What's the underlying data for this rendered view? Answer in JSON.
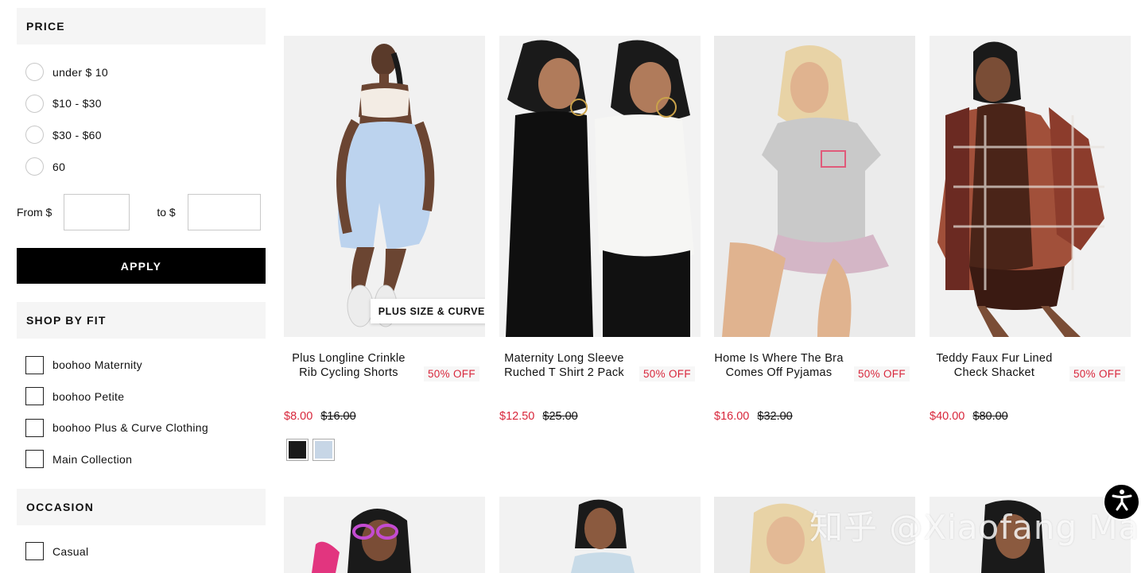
{
  "filters": {
    "price": {
      "heading": "PRICE",
      "options": [
        "under $ 10",
        "$10 - $30",
        "$30 - $60",
        "60"
      ],
      "from_label": "From $",
      "to_label": "to $",
      "from_value": "",
      "to_value": "",
      "apply_label": "APPLY"
    },
    "fit": {
      "heading": "SHOP BY FIT",
      "options": [
        "boohoo Maternity",
        "boohoo Petite",
        "boohoo Plus & Curve Clothing",
        "Main Collection"
      ]
    },
    "occasion": {
      "heading": "OCCASION",
      "options": [
        "Casual"
      ]
    }
  },
  "products": [
    {
      "name": "Plus Longline Crinkle Rib Cycling Shorts",
      "discount": "50% OFF",
      "price": "$8.00",
      "original_price": "$16.00",
      "badge": "PLUS SIZE & CURVE",
      "swatches": [
        "#1a1a1a",
        "#c7d6e6"
      ]
    },
    {
      "name": "Maternity Long Sleeve Ruched T Shirt 2 Pack",
      "discount": "50% OFF",
      "price": "$12.50",
      "original_price": "$25.00"
    },
    {
      "name": "Home Is Where The Bra Comes Off Pyjamas",
      "discount": "50% OFF",
      "price": "$16.00",
      "original_price": "$32.00"
    },
    {
      "name": "Teddy Faux Fur Lined Check Shacket",
      "discount": "50% OFF",
      "price": "$40.00",
      "original_price": "$80.00"
    }
  ],
  "watermark": "知乎 @Xiaofang Ma",
  "colors": {
    "sale_red": "#d8263b",
    "button_black": "#000000",
    "section_grey": "#f5f5f5"
  },
  "icons": {
    "accessibility": "accessibility-icon"
  }
}
